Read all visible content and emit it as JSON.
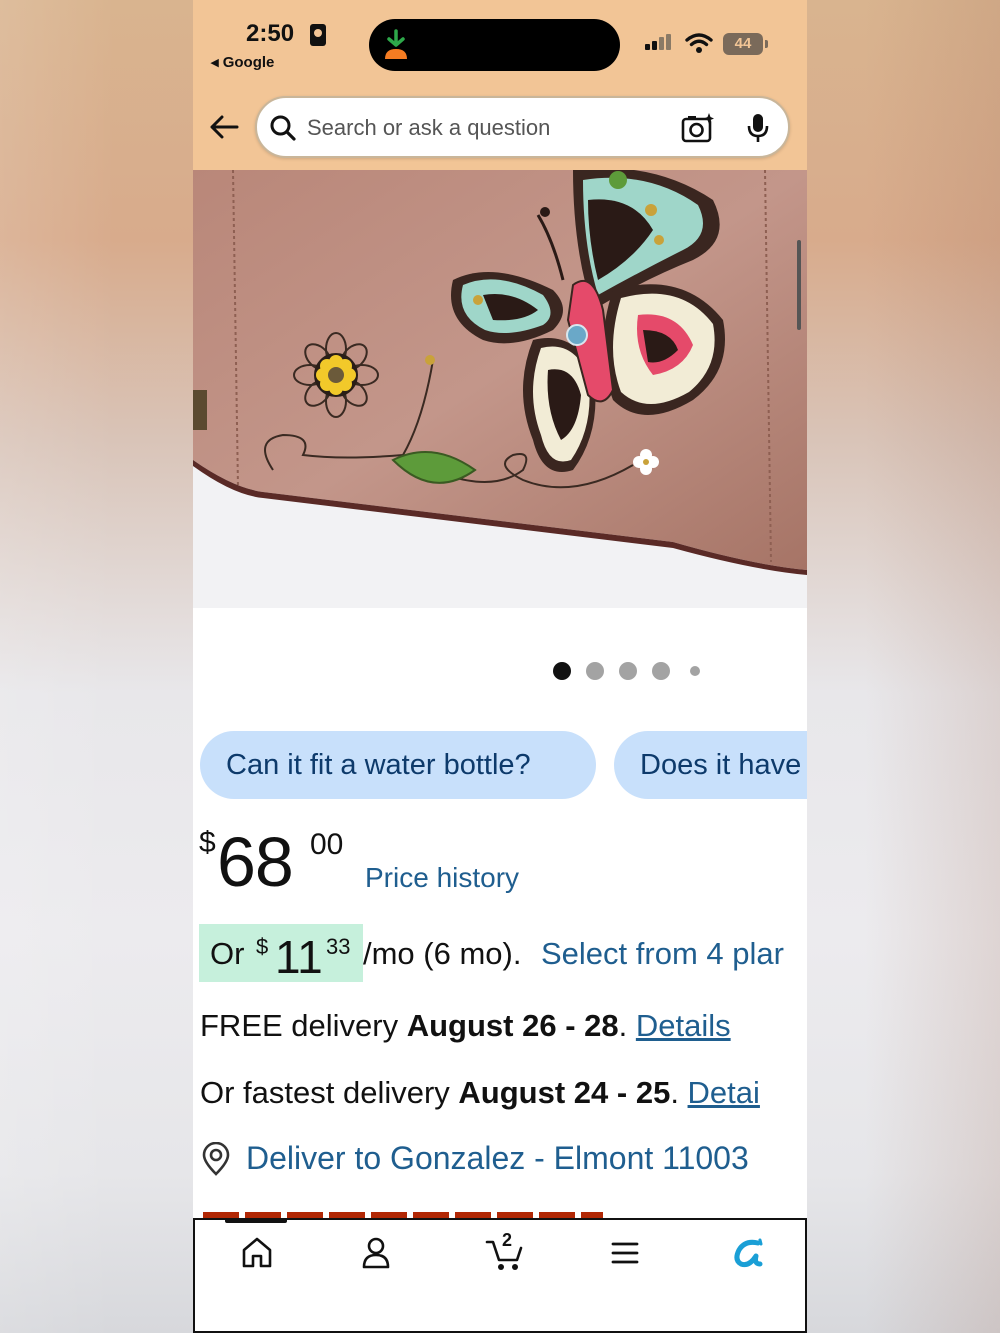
{
  "status_bar": {
    "time": "2:50",
    "back_app": "◂ Google",
    "battery": "44"
  },
  "search": {
    "placeholder": "Search or ask a question"
  },
  "gallery": {
    "image_count": 5,
    "active_index": 0
  },
  "suggestions": [
    {
      "label": "Can it fit a water bottle?"
    },
    {
      "label": "Does it have"
    }
  ],
  "price": {
    "currency": "$",
    "whole": "68",
    "cents": "00",
    "history_label": "Price history"
  },
  "installment": {
    "prefix": "Or",
    "currency": "$",
    "whole": "11",
    "cents": "33",
    "suffix": "/mo (6 mo).",
    "link": "Select from 4 plar"
  },
  "delivery": {
    "free_prefix": "FREE delivery ",
    "free_dates": "August 26 - 28",
    "free_sep": ". ",
    "free_link": "Details",
    "fast_prefix": "Or fastest delivery ",
    "fast_dates": "August 24 - 25",
    "fast_sep": ". ",
    "fast_link": "Detai",
    "deliver_to": "Deliver to Gonzalez - Elmont 11003"
  },
  "bottom_nav": {
    "items": [
      {
        "icon": "home-icon"
      },
      {
        "icon": "account-icon"
      },
      {
        "icon": "cart-icon",
        "count": "2"
      },
      {
        "icon": "menu-icon"
      },
      {
        "icon": "rufus-assistant-icon"
      }
    ],
    "active_index": 0
  },
  "colors": {
    "header": "#f2c596",
    "link": "#1f5e8f",
    "chip": "#c8e0fb",
    "installment_highlight": "#c6f0dc",
    "assistant_icon": "#1a9fd6"
  }
}
